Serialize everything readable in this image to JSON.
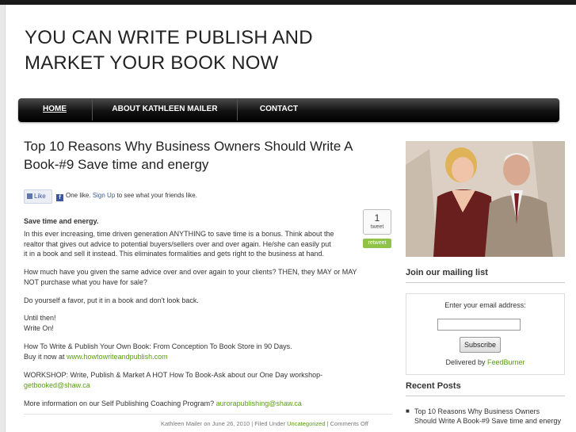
{
  "site": {
    "title_line1": "YOU CAN WRITE PUBLISH AND",
    "title_line2": "MARKET YOUR BOOK NOW"
  },
  "nav": {
    "home": "HOME",
    "about": "ABOUT KATHLEEN MAILER",
    "contact": "CONTACT"
  },
  "post": {
    "title_line1": "Top 10 Reasons Why Business Owners Should Write A",
    "title_line2": "Book-#9 Save time and energy",
    "facebook": {
      "like_label": "Like",
      "like_count_text": "One like.",
      "signup_link": "Sign Up",
      "signup_suffix": "to see what your friends like."
    },
    "tweet": {
      "count": "1",
      "label": "tweet",
      "retweet_label": "retweet"
    },
    "heading": "Save time and energy.",
    "para1_line1": "In this ever increasing, time driven generation ANYTHING to save time is a bonus. Think about the",
    "para1_line2": "realtor that gives out advice to potential buyers/sellers over and over again. He/she can easily put",
    "para1_line3": "it in a book and sell it instead. This eliminates formalities and gets right to the business at hand.",
    "para2_line1": "How much have you given the same advice over and over again to your clients? THEN, they MAY or MAY",
    "para2_line2": "NOT purchase what you have for sale?",
    "para3": "Do yourself a favor, put it in a book and don't look back.",
    "para4_line1": "Until then!",
    "para4_line2": "Write On!",
    "para5_line1": "How To Write & Publish Your Own Book: From Conception To Book Store in 90 Days.",
    "para5_line2_prefix": "Buy it now at",
    "para5_link": "www.howtowriteandpublish.com",
    "para6_line1": "WORKSHOP: Write, Publish & Market A HOT How To Book-Ask about our One Day workshop-",
    "para6_link": "getbooked@shaw.ca",
    "para7_prefix": "More information on our Self Publishing Coaching Program?",
    "para7_link": "aurorapublishing@shaw.ca",
    "meta_author_date": "Kathleen Mailer on June 26, 2010 | Filed Under",
    "meta_category": "Uncategorized",
    "meta_comments": "| Comments Off"
  },
  "sidebar": {
    "mailing_heading": "Join our mailing list",
    "email_label": "Enter your email address:",
    "email_value": "",
    "subscribe_label": "Subscribe",
    "delivered_prefix": "Delivered by",
    "delivered_link": "FeedBurner",
    "recent_heading": "Recent Posts",
    "recent_posts": [
      "Top 10 Reasons Why Business Owners Should Write A Book-#9 Save time and energy"
    ]
  },
  "colors": {
    "link_green": "#5a9e12",
    "nav_bg": "#111111",
    "facebook_blue": "#3b5998",
    "retweet_green": "#8fc448"
  }
}
